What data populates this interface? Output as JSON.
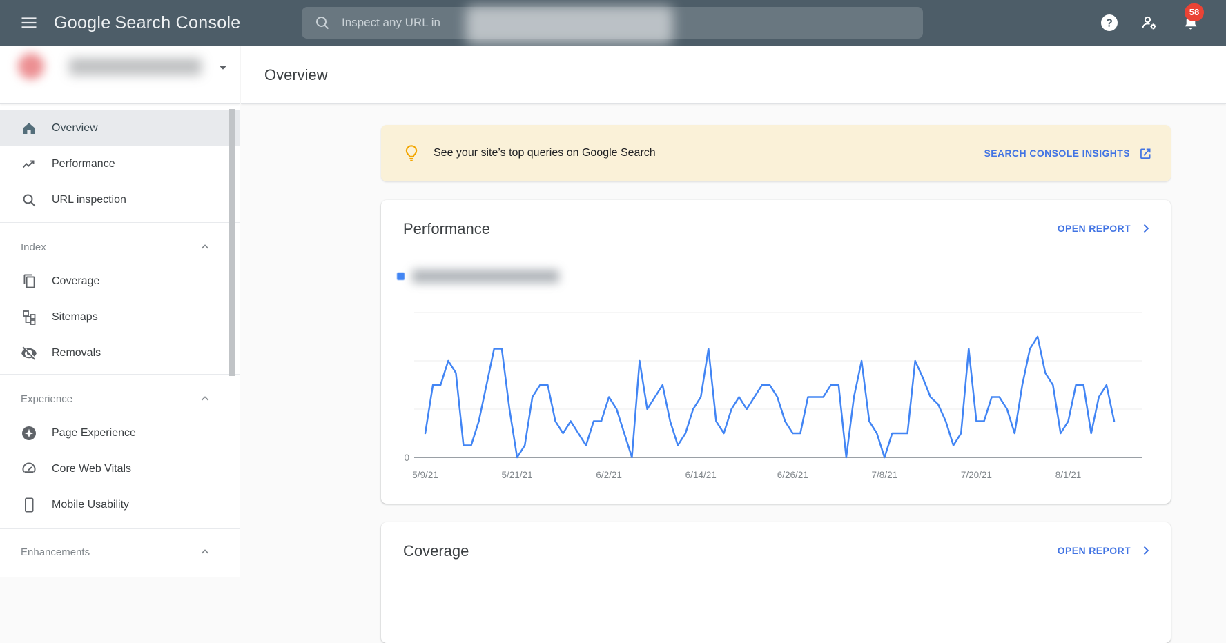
{
  "topbar": {
    "logo_google": "Google",
    "logo_rest": "Search Console",
    "search_placeholder": "Inspect any URL in",
    "search_property_redacted": true,
    "help_glyph": "?",
    "notification_count": "58"
  },
  "sidebar": {
    "property_selector_redacted": true,
    "top_items": [
      {
        "label": "Overview",
        "selected": true
      },
      {
        "label": "Performance",
        "selected": false
      },
      {
        "label": "URL inspection",
        "selected": false
      }
    ],
    "sections": [
      {
        "header": "Index",
        "items": [
          {
            "label": "Coverage"
          },
          {
            "label": "Sitemaps"
          },
          {
            "label": "Removals"
          }
        ]
      },
      {
        "header": "Experience",
        "items": [
          {
            "label": "Page Experience"
          },
          {
            "label": "Core Web Vitals"
          },
          {
            "label": "Mobile Usability"
          }
        ]
      },
      {
        "header": "Enhancements",
        "items": []
      }
    ]
  },
  "page": {
    "title": "Overview"
  },
  "banner": {
    "text": "See your site’s top queries on Google Search",
    "link": "SEARCH CONSOLE INSIGHTS"
  },
  "performance_card": {
    "title": "Performance",
    "action": "OPEN REPORT",
    "legend_text_redacted": true
  },
  "coverage_card": {
    "title": "Coverage",
    "action": "OPEN REPORT"
  },
  "chart_data": {
    "type": "line",
    "title": "Performance – daily total web search clicks (legend text blurred in screenshot)",
    "x_tick_labels": [
      "5/9/21",
      "5/21/21",
      "6/2/21",
      "6/14/21",
      "6/26/21",
      "7/8/21",
      "7/20/21",
      "8/1/21"
    ],
    "x_tick_indices": [
      0,
      12,
      24,
      36,
      48,
      60,
      72,
      84
    ],
    "y_axis_shown_tick": "0",
    "ylim": [
      0,
      6
    ],
    "gridline_values": [
      2,
      4,
      6
    ],
    "grid_on": true,
    "legend_position": "top-left",
    "line_color": "#4285f4",
    "values": [
      1,
      3,
      3,
      4,
      3.5,
      0.5,
      0.5,
      1.5,
      3,
      4.5,
      4.5,
      2,
      0,
      0.5,
      2.5,
      3,
      3,
      1.5,
      1,
      1.5,
      1,
      0.5,
      1.5,
      1.5,
      2.5,
      2,
      1,
      0,
      4,
      2,
      2.5,
      3,
      1.5,
      0.5,
      1,
      2,
      2.5,
      4.5,
      1.5,
      1,
      2,
      2.5,
      2,
      2.5,
      3,
      3,
      2.5,
      1.5,
      1,
      1,
      2.5,
      2.5,
      2.5,
      3,
      3,
      0,
      2.5,
      4,
      1.5,
      1,
      0,
      1,
      1,
      1,
      4,
      3.3,
      2.5,
      2.2,
      1.5,
      0.5,
      1,
      4.5,
      1.5,
      1.5,
      2.5,
      2.5,
      2,
      1,
      3,
      4.5,
      5,
      3.5,
      3,
      1,
      1.5,
      3,
      3,
      1,
      2.5,
      3,
      1.5
    ]
  },
  "colors": {
    "topbar_bg": "#4d5d68",
    "link_blue": "#4274e3",
    "chart_blue": "#4285f4",
    "banner_bg": "#faf1d8",
    "badge_red": "#ea4335",
    "bulb_amber": "#f2a600",
    "selected_item_bg": "#e8eaed"
  }
}
